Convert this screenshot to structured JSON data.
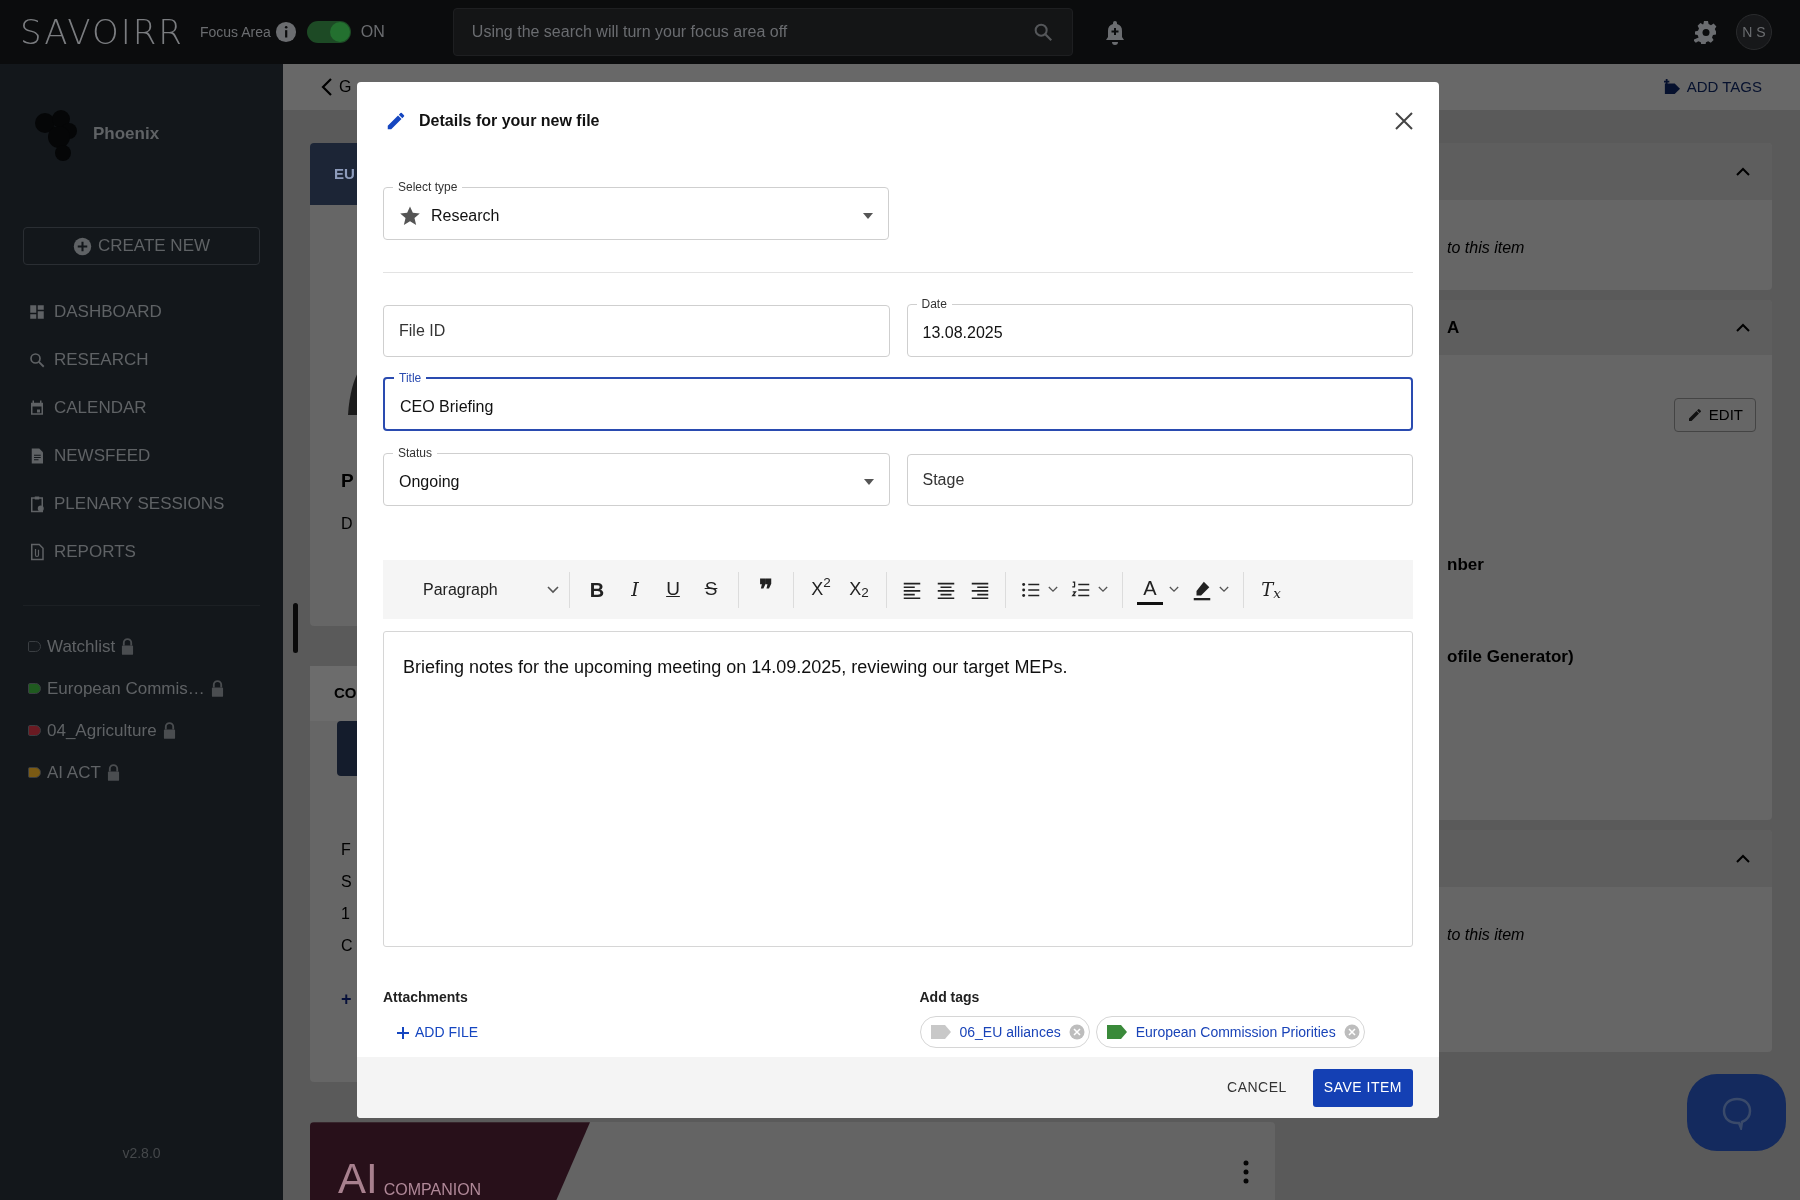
{
  "top_bar": {
    "logo": "SAVOIRR",
    "focus_label": "Focus Area",
    "focus_on": true,
    "focus_state": "ON",
    "search_placeholder": "Using the search will turn your focus area off",
    "avatar": "N S"
  },
  "sidebar": {
    "workspace": "Phoenix",
    "create_button": "CREATE NEW",
    "nav": [
      {
        "kind": "dashboard",
        "label": "DASHBOARD"
      },
      {
        "kind": "search",
        "label": "RESEARCH"
      },
      {
        "kind": "calendar",
        "label": "CALENDAR"
      },
      {
        "kind": "document",
        "label": "NEWSFEED"
      },
      {
        "kind": "clipboard",
        "label": "PLENARY SESSIONS"
      },
      {
        "kind": "attachment",
        "label": "REPORTS"
      }
    ],
    "lists": [
      {
        "label": "Watchlist",
        "color": "#15191d",
        "locked": true
      },
      {
        "label": "European Commis…",
        "color": "#1f5a1f",
        "locked": true
      },
      {
        "label": "04_Agriculture",
        "color": "#6a1a22",
        "locked": true
      },
      {
        "label": "AI ACT",
        "color": "#7a5a14",
        "locked": true
      }
    ],
    "version": "v2.8.0"
  },
  "background": {
    "back_label": "G",
    "card_header": "EU",
    "heading_letter": "P",
    "line_letter": "D",
    "section_header": "CO",
    "lines": [
      "F",
      "S",
      "1",
      "C"
    ],
    "add_link": "+",
    "companion_logo": [
      "AI",
      "COMPANION"
    ],
    "add_tags": "ADD TAGS",
    "panels": [
      {
        "lines": [
          {
            "text": "to this item",
            "kind": "empty"
          }
        ]
      },
      {
        "header": "A",
        "edit_button": "EDIT",
        "lines": [
          {
            "text": "nber",
            "kind": "bold"
          },
          {
            "text": "ofile Generator)",
            "kind": "bold"
          }
        ]
      },
      {
        "lines": [
          {
            "text": "to this item",
            "kind": "empty"
          }
        ]
      }
    ]
  },
  "modal": {
    "title": "Details for your new file",
    "type_field": {
      "label": "Select type",
      "value": "Research"
    },
    "file_id": {
      "placeholder": "File ID"
    },
    "date": {
      "label": "Date",
      "value": "13.08.2025"
    },
    "title_field": {
      "label": "Title",
      "value": "CEO Briefing",
      "focused": true
    },
    "status": {
      "label": "Status",
      "value": "Ongoing"
    },
    "stage": {
      "placeholder": "Stage"
    },
    "toolbar": {
      "block_style": "Paragraph",
      "groups": [
        [
          {
            "kind": "bold",
            "glyph": "B"
          },
          {
            "kind": "italic",
            "glyph": "I"
          },
          {
            "kind": "underline",
            "glyph": "U"
          },
          {
            "kind": "strike",
            "glyph": "S"
          }
        ],
        [
          {
            "kind": "quote",
            "glyph": "❞"
          }
        ],
        [
          {
            "kind": "superscript",
            "glyph": "X$^{2}$"
          },
          {
            "kind": "subscript",
            "glyph": "X$_{2}$"
          }
        ],
        [
          {
            "kind": "align-left"
          },
          {
            "kind": "align-center"
          },
          {
            "kind": "align-right"
          }
        ],
        [
          {
            "kind": "bullets",
            "dropdown": true
          },
          {
            "kind": "numbers",
            "dropdown": true
          }
        ],
        [
          {
            "kind": "font-color",
            "glyph": "A",
            "dropdown": true
          },
          {
            "kind": "highlight",
            "dropdown": true
          }
        ],
        [
          {
            "kind": "clear",
            "glyph": "T$_{x}$"
          }
        ]
      ]
    },
    "body": "Briefing notes for the upcoming meeting on 14.09.2025, reviewing our target MEPs.",
    "attachments_label": "Attachments",
    "add_file": "ADD FILE",
    "tags_label": "Add tags",
    "tags": [
      {
        "label": "06_EU alliances",
        "color": "#c8c8c8"
      },
      {
        "label": "European Commission Priorities",
        "color": "#3a8a3a"
      }
    ],
    "cancel": "CANCEL",
    "save": "SAVE ITEM"
  }
}
